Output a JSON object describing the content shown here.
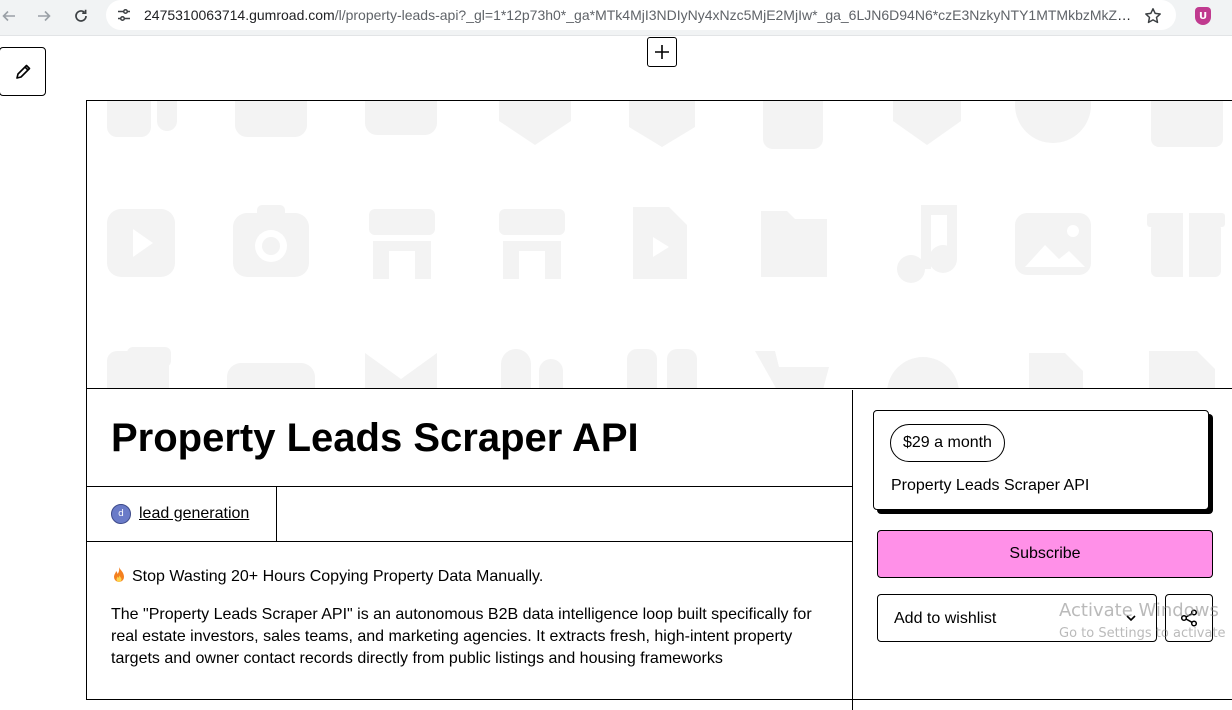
{
  "browser": {
    "url_host": "2475310063714.gumroad.com",
    "url_path": "/l/property-leads-api?_gl=1*12p73h0*_ga*MTk4MjI3NDIyNy4xNzc5MjE2MjIw*_ga_6LJN6D94N6*czE3NzkyNTY1MTMkbzMkZzE...",
    "ext_label": "U",
    "icons": {
      "back": "arrow-left-icon",
      "forward": "arrow-right-icon",
      "reload": "reload-icon",
      "site_info": "tune-icon",
      "bookmark": "star-icon",
      "extension": "shield-icon"
    }
  },
  "toolbar": {
    "edit_icon": "pencil-icon",
    "add_icon": "plus-icon"
  },
  "product": {
    "title": "Property Leads Scraper API",
    "creator_initial": "d",
    "creator_name": "lead generation",
    "description": {
      "headline": "Stop Wasting 20+ Hours Copying Property Data Manually.",
      "headline_icon": "fire-icon",
      "body": "The \"Property Leads Scraper API\" is an autonomous B2B data intelligence loop built specifically for real estate investors, sales teams, and marketing agencies. It extracts fresh, high-intent property targets and owner contact records directly from public listings and housing frameworks"
    }
  },
  "purchase": {
    "price_label": "$29 a month",
    "card_title": "Property Leads Scraper API",
    "subscribe_label": "Subscribe",
    "wishlist_label": "Add to wishlist",
    "share_icon": "share-icon"
  },
  "watermark": {
    "title": "Activate Windows",
    "subtitle": "Go to Settings to activate"
  },
  "colors": {
    "accent_pink": "#ff90e8",
    "cover_icons": "#f2f2f2",
    "border": "#000000"
  }
}
